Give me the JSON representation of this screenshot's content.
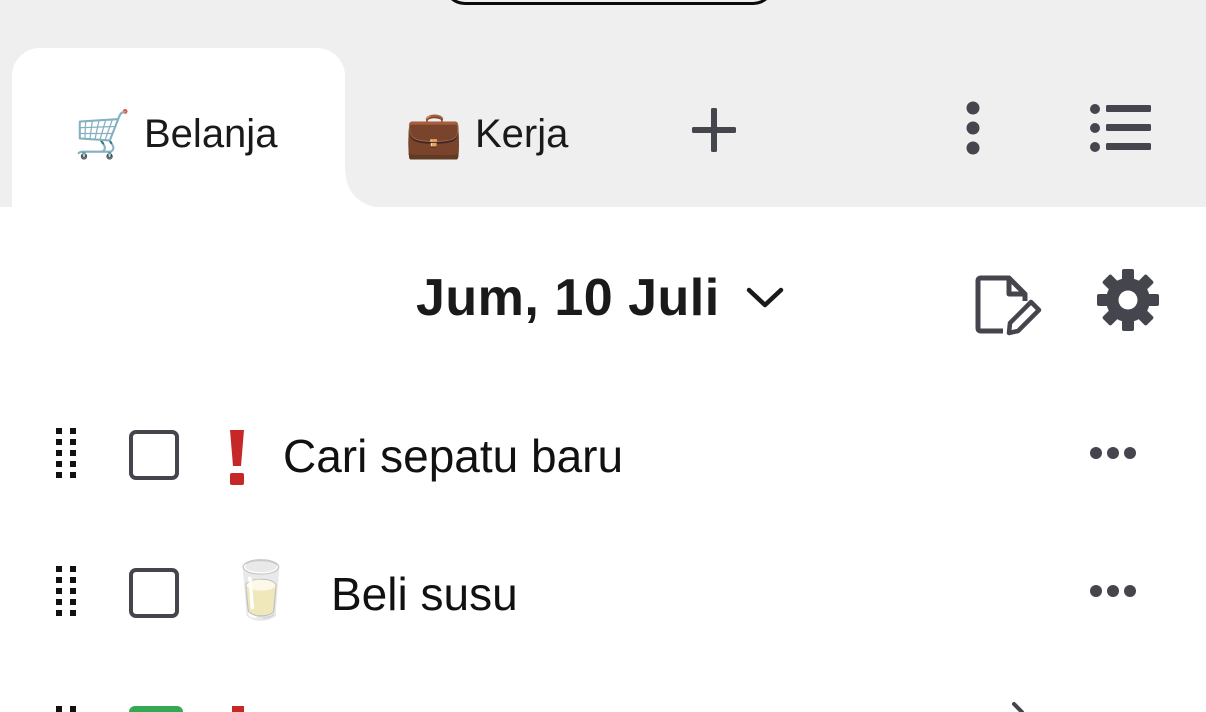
{
  "tabs": [
    {
      "icon": "shopping-cart-icon",
      "emoji": "🛒",
      "label": "Belanja",
      "active": true
    },
    {
      "icon": "briefcase-icon",
      "emoji": "💼",
      "label": "Kerja",
      "active": false
    }
  ],
  "toolbar": {
    "add_icon": "plus-icon",
    "menu_icon": "vertical-dots-icon",
    "list_icon": "list-icon"
  },
  "header": {
    "date": "Jum, 10 Juli",
    "dropdown_icon": "chevron-down-icon",
    "edit_icon": "edit-note-icon",
    "settings_icon": "gear-icon"
  },
  "tasks": [
    {
      "title": "Cari sepatu baru",
      "marker": "priority-exclamation-icon",
      "checked": false
    },
    {
      "title": "Beli susu",
      "marker": "milk-glass-icon",
      "emoji": "🥛",
      "checked": false
    }
  ],
  "colors": {
    "tab_bar_bg": "#efefef",
    "priority_red": "#c62828",
    "checkbox_border": "#45454d",
    "icon_dark": "#45454d",
    "accent_green": "#34a853"
  }
}
